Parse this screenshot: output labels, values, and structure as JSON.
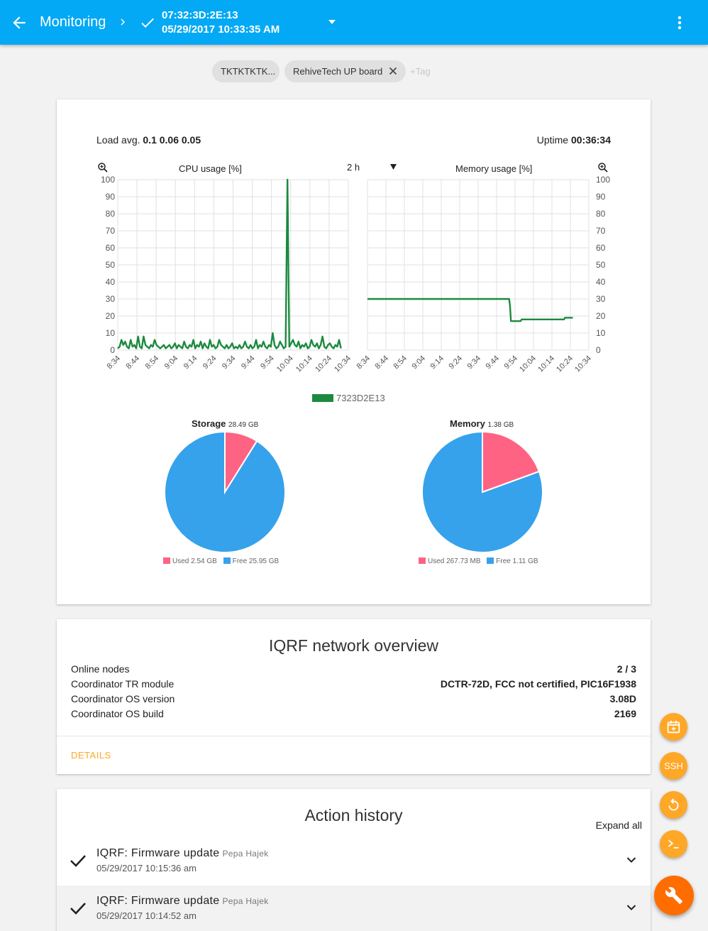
{
  "appbar": {
    "title": "Monitoring",
    "device_id": "07:32:3D:2E:13",
    "device_date": "05/29/2017 10:33:35 AM",
    "color": "#03a9f4"
  },
  "tags": {
    "items": [
      "TKTKTKTK...",
      "RehiveTech UP board"
    ],
    "add_label": "+Tag"
  },
  "stats": {
    "load_label": "Load avg.",
    "load_value": "0.1 0.06 0.05",
    "uptime_label": "Uptime",
    "uptime_value": "00:36:34"
  },
  "charts": {
    "range": "2 h"
  },
  "chart_data": [
    {
      "type": "line",
      "title": "CPU usage [%]",
      "ylim": [
        0,
        100
      ],
      "yticks": [
        0,
        10,
        20,
        30,
        40,
        50,
        60,
        70,
        80,
        90,
        100
      ],
      "xticks": [
        "8:34",
        "8:44",
        "8:54",
        "9:04",
        "9:14",
        "9:24",
        "9:34",
        "9:44",
        "9:54",
        "10:04",
        "10:14",
        "10:24",
        "10:34"
      ],
      "grid": true,
      "series": [
        {
          "name": "7323D2E13",
          "color": "#1b8a3f",
          "x_minutes": [
            0,
            1,
            2,
            3,
            4,
            5,
            6,
            7,
            8,
            9,
            10,
            11,
            12,
            13,
            14,
            15,
            16,
            17,
            18,
            19,
            20,
            21,
            22,
            23,
            24,
            25,
            26,
            27,
            28,
            29,
            30,
            31,
            32,
            33,
            34,
            35,
            36,
            37,
            38,
            39,
            40,
            41,
            42,
            43,
            44,
            45,
            46,
            47,
            48,
            49,
            50,
            51,
            52,
            53,
            54,
            55,
            56,
            57,
            58,
            59,
            60,
            61,
            62,
            63,
            64,
            65,
            66,
            67,
            68,
            69,
            70,
            71,
            72,
            73,
            74,
            75,
            76,
            77,
            78,
            79,
            80,
            81,
            82,
            83,
            84,
            85,
            86,
            87,
            88,
            89,
            90,
            91,
            92,
            93,
            94,
            95,
            96,
            97,
            98,
            99,
            100,
            101,
            102,
            103,
            104,
            105,
            106,
            107,
            108,
            109,
            110,
            111,
            112,
            113,
            114,
            115,
            116,
            117,
            118,
            119,
            120,
            121,
            122,
            123,
            124,
            125
          ],
          "values": [
            1,
            2,
            6,
            3,
            5,
            2,
            1,
            6,
            2,
            3,
            1,
            8,
            2,
            1,
            8,
            3,
            2,
            1,
            3,
            2,
            6,
            3,
            2,
            1,
            2,
            3,
            1,
            2,
            3,
            1,
            2,
            4,
            1,
            3,
            2,
            1,
            5,
            2,
            1,
            3,
            2,
            6,
            1,
            3,
            2,
            5,
            1,
            4,
            2,
            1,
            6,
            2,
            3,
            1,
            2,
            6,
            3,
            2,
            1,
            3,
            1,
            2,
            4,
            1,
            2,
            1,
            3,
            1,
            2,
            5,
            2,
            1,
            3,
            1,
            2,
            6,
            1,
            3,
            2,
            5,
            2,
            1,
            3,
            2,
            10,
            3,
            1,
            2,
            5,
            3,
            1,
            2,
            100,
            2,
            4,
            6,
            3,
            2,
            5,
            1,
            3,
            2,
            4,
            1,
            2,
            6,
            3,
            2,
            4,
            1,
            3,
            8,
            2,
            1,
            3,
            4,
            2,
            1,
            3,
            2,
            6,
            1
          ]
        }
      ]
    },
    {
      "type": "line",
      "title": "Memory usage [%]",
      "ylim": [
        0,
        100
      ],
      "yticks": [
        0,
        10,
        20,
        30,
        40,
        50,
        60,
        70,
        80,
        90,
        100
      ],
      "xticks": [
        "8:34",
        "8:44",
        "8:54",
        "9:04",
        "9:14",
        "9:24",
        "9:34",
        "9:44",
        "9:54",
        "10:04",
        "10:14",
        "10:24",
        "10:34"
      ],
      "grid": true,
      "series": [
        {
          "name": "7323D2E13",
          "color": "#1b8a3f",
          "x_minutes": [
            0,
            80,
            80.5,
            81,
            86.5,
            87,
            111,
            111.5,
            116
          ],
          "values": [
            30,
            30,
            26,
            17,
            17,
            18,
            18,
            19,
            19
          ]
        }
      ],
      "legend": "bottom-center"
    },
    {
      "type": "pie",
      "title": "Storage",
      "subtitle": "28.49 GB",
      "slices": [
        {
          "label": "Used 2.54 GB",
          "value": 2.54,
          "color": "#ff6384"
        },
        {
          "label": "Free 25.95 GB",
          "value": 25.95,
          "color": "#36a2eb"
        }
      ]
    },
    {
      "type": "pie",
      "title": "Memory",
      "subtitle": "1.38 GB",
      "slices": [
        {
          "label": "Used 267.73 MB",
          "value": 0.268,
          "color": "#ff6384"
        },
        {
          "label": "Free 1.11 GB",
          "value": 1.11,
          "color": "#36a2eb"
        }
      ]
    }
  ],
  "iqrf": {
    "title": "IQRF network overview",
    "rows": [
      {
        "label": "Online nodes",
        "value": "2 / 3"
      },
      {
        "label": "Coordinator TR module",
        "value": "DCTR-72D, FCC not certified, PIC16F1938"
      },
      {
        "label": "Coordinator OS version",
        "value": "3.08D"
      },
      {
        "label": "Coordinator OS build",
        "value": "2169"
      }
    ],
    "details_label": "DETAILS"
  },
  "history": {
    "title": "Action history",
    "expand_all": "Expand all",
    "items": [
      {
        "name": "IQRF: Firmware update",
        "user": "Pepa Hajek",
        "time": "05/29/2017 10:15:36 am"
      },
      {
        "name": "IQRF: Firmware update",
        "user": "Pepa Hajek",
        "time": "05/29/2017 10:14:52 am"
      }
    ]
  },
  "fabs": {
    "ssh_label": "SSH",
    "small_color": "#ffa726",
    "main_color": "#ff6d00"
  }
}
